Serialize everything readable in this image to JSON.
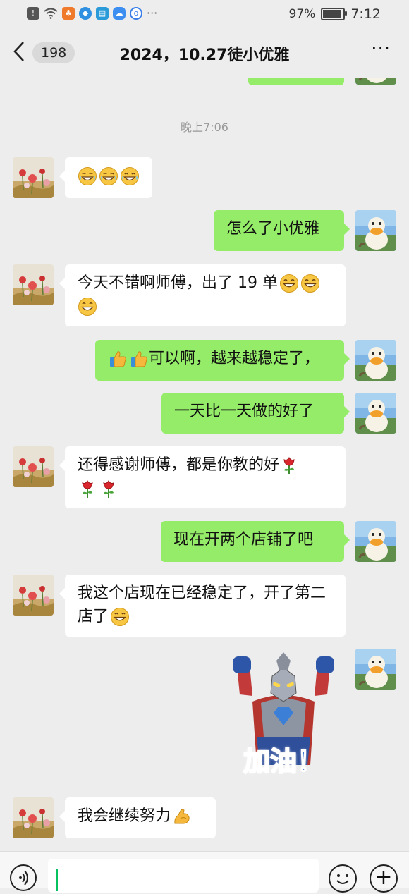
{
  "status_bar": {
    "battery": "97%",
    "time": "7:12",
    "battery_level": 0.97,
    "dots": "···"
  },
  "header": {
    "back_icon": "chevron-left-icon",
    "unread_count": "198",
    "title": "2024，10.27徒小优雅",
    "more_label": "···"
  },
  "time_label": "晚上7:06",
  "messages": [
    {
      "side": "in",
      "text": "",
      "emoji_after": [
        "grin-sweat",
        "grin-sweat",
        "grin-sweat"
      ]
    },
    {
      "side": "out",
      "text": "怎么了小优雅"
    },
    {
      "side": "in",
      "text": "今天不错啊师傅，出了 19 单",
      "emoji_after": [
        "grin",
        "grin",
        "grin"
      ]
    },
    {
      "side": "out",
      "text": "可以啊，越来越稳定了，",
      "emoji_before": [
        "thumbs-up",
        "thumbs-up"
      ]
    },
    {
      "side": "out",
      "text": "一天比一天做的好了"
    },
    {
      "side": "in",
      "text": "还得感谢师傅，都是你教的好",
      "emoji_after": [
        "rose",
        "rose",
        "rose"
      ]
    },
    {
      "side": "out",
      "text": "现在开两个店铺了吧"
    },
    {
      "side": "in",
      "text": "我这个店现在已经稳定了，开了第二店了",
      "emoji_after": [
        "grin"
      ]
    },
    {
      "side": "out",
      "sticker": "hero-sticker",
      "sticker_text": "加油！"
    },
    {
      "side": "in",
      "text": "我会继续努力",
      "emoji_after": [
        "flexed-biceps"
      ]
    }
  ],
  "input_bar": {
    "voice_icon": "voice-icon",
    "emoji_icon": "smiley-icon",
    "plus_icon": "plus-icon",
    "plus_label": "+"
  },
  "colors": {
    "outgoing_bubble": "#95ec69",
    "incoming_bubble": "#ffffff",
    "background": "#ededed",
    "cursor": "#07c160"
  }
}
